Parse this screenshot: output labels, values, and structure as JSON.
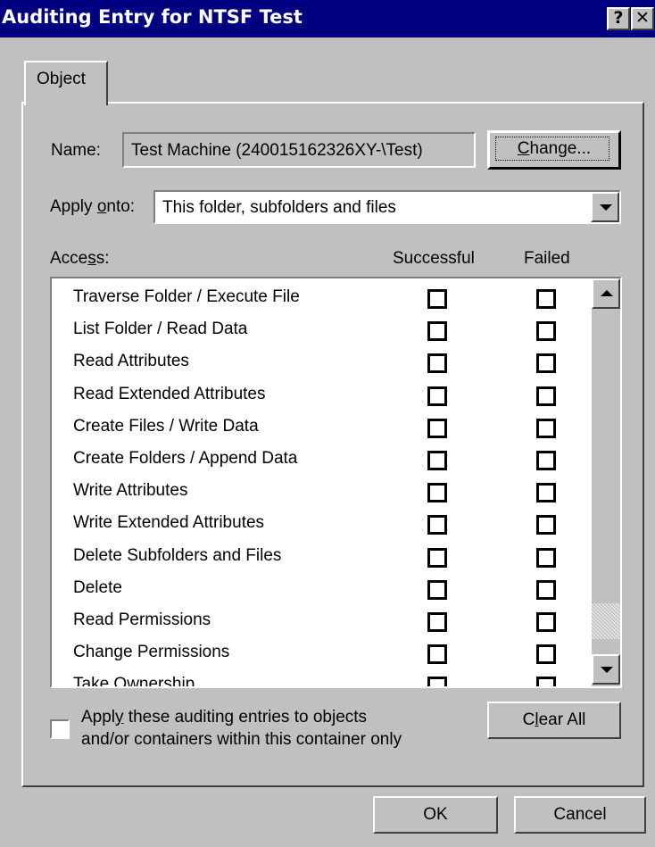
{
  "window": {
    "title": "Auditing Entry for NTSF Test",
    "help_glyph": "?",
    "close_glyph": "✕"
  },
  "tabs": [
    {
      "label": "Object"
    }
  ],
  "name_field": {
    "label": "Name:",
    "value": "Test Machine (240015162326XY-\\Test)",
    "change_button": "Change..."
  },
  "apply_onto": {
    "label": "Apply onto:",
    "selected": "This folder, subfolders and files"
  },
  "access": {
    "header": "Access:",
    "col_successful": "Successful",
    "col_failed": "Failed",
    "items": [
      {
        "label": "Traverse Folder / Execute File",
        "successful": false,
        "failed": false
      },
      {
        "label": "List Folder / Read Data",
        "successful": false,
        "failed": false
      },
      {
        "label": "Read Attributes",
        "successful": false,
        "failed": false
      },
      {
        "label": "Read Extended Attributes",
        "successful": false,
        "failed": false
      },
      {
        "label": "Create Files / Write Data",
        "successful": false,
        "failed": false
      },
      {
        "label": "Create Folders / Append Data",
        "successful": false,
        "failed": false
      },
      {
        "label": "Write Attributes",
        "successful": false,
        "failed": false
      },
      {
        "label": "Write Extended Attributes",
        "successful": false,
        "failed": false
      },
      {
        "label": "Delete Subfolders and Files",
        "successful": false,
        "failed": false
      },
      {
        "label": "Delete",
        "successful": false,
        "failed": false
      },
      {
        "label": "Read Permissions",
        "successful": false,
        "failed": false
      },
      {
        "label": "Change Permissions",
        "successful": false,
        "failed": false
      },
      {
        "label": "Take Ownership",
        "successful": false,
        "failed": false
      }
    ]
  },
  "apply_container_only": {
    "line1": "Apply these auditing entries to objects",
    "line2": "and/or containers within this container only",
    "checked": false
  },
  "clear_all_button": "Clear All",
  "ok_button": "OK",
  "cancel_button": "Cancel",
  "colors": {
    "titlebar": "#000080",
    "dialog_face": "#c0c0c0",
    "window": "#ffffff"
  }
}
